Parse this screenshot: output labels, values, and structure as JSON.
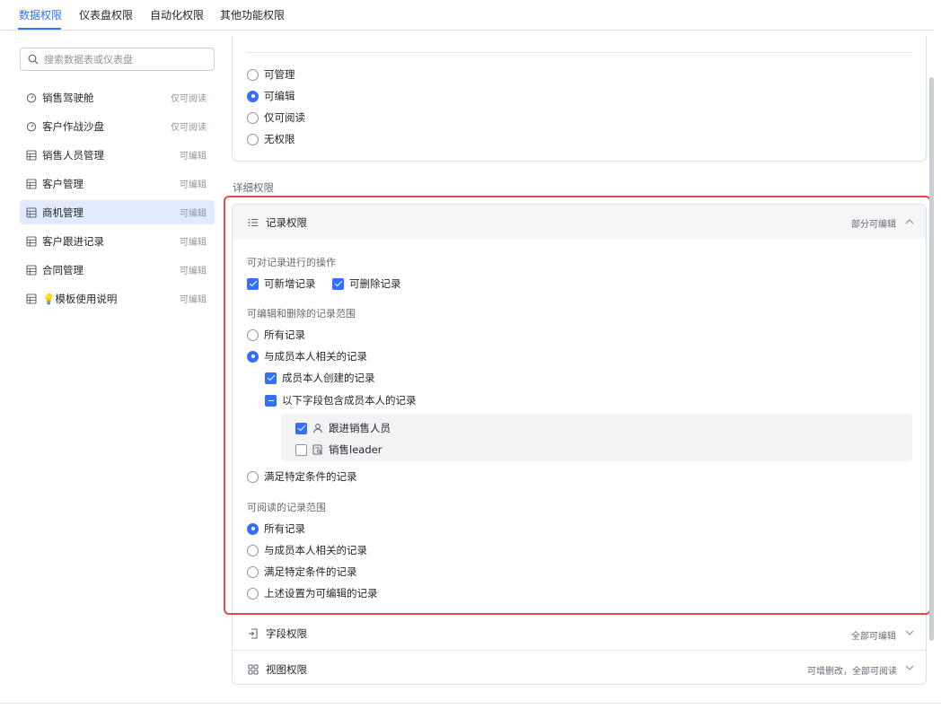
{
  "tabs": [
    "数据权限",
    "仪表盘权限",
    "自动化权限",
    "其他功能权限"
  ],
  "search": {
    "placeholder": "搜索数据表或仪表盘"
  },
  "sidebar": {
    "items": [
      {
        "label": "销售驾驶舱",
        "perm": "仅可阅读",
        "icon": "dashboard-icon"
      },
      {
        "label": "客户作战沙盘",
        "perm": "仅可阅读",
        "icon": "dashboard-icon"
      },
      {
        "label": "销售人员管理",
        "perm": "可编辑",
        "icon": "table-icon"
      },
      {
        "label": "客户管理",
        "perm": "可编辑",
        "icon": "table-icon"
      },
      {
        "label": "商机管理",
        "perm": "可编辑",
        "icon": "table-icon"
      },
      {
        "label": "客户跟进记录",
        "perm": "可编辑",
        "icon": "table-icon"
      },
      {
        "label": "合同管理",
        "perm": "可编辑",
        "icon": "table-icon"
      },
      {
        "label": "💡模板使用说明",
        "perm": "可编辑",
        "icon": "table-icon"
      }
    ],
    "active_index": 4
  },
  "table_perm_options": [
    "可管理",
    "可编辑",
    "仅可阅读",
    "无权限"
  ],
  "table_perm_selected": "可编辑",
  "detail_title": "详细权限",
  "record_section": {
    "title": "记录权限",
    "status": "部分可编辑",
    "ops_label": "可对记录进行的操作",
    "ops": [
      {
        "label": "可新增记录",
        "checked": true
      },
      {
        "label": "可删除记录",
        "checked": true
      }
    ],
    "edit_scope_label": "可编辑和删除的记录范围",
    "edit_scope": {
      "all": "所有记录",
      "related": "与成员本人相关的记录",
      "created_by": "成员本人创建的记录",
      "fields_contain": "以下字段包含成员本人的记录",
      "fields": [
        {
          "label": "跟进销售人员",
          "checked": true,
          "icon": "person-icon"
        },
        {
          "label": "销售leader",
          "checked": false,
          "icon": "lookup-field-icon"
        }
      ],
      "condition": "满足特定条件的记录"
    },
    "read_scope_label": "可阅读的记录范围",
    "read_scope": [
      "所有记录",
      "与成员本人相关的记录",
      "满足特定条件的记录",
      "上述设置为可编辑的记录"
    ]
  },
  "field_section": {
    "title": "字段权限",
    "status": "全部可编辑"
  },
  "view_section": {
    "title": "视图权限",
    "status": "可增删改，全部可阅读"
  },
  "colors": {
    "accent": "#3370ff",
    "highlight": "#e5484d"
  }
}
